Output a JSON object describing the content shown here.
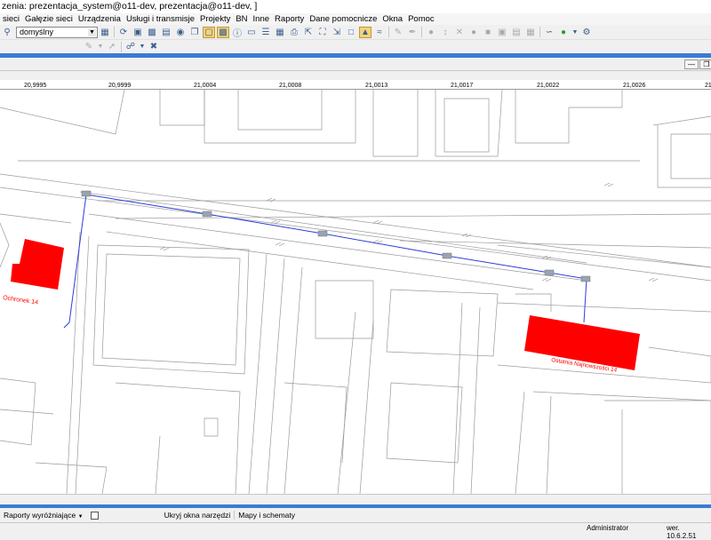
{
  "window": {
    "title": "zenia: prezentacja_system@o11-dev, prezentacja@o11-dev, ]"
  },
  "menu": {
    "items": [
      "sieci",
      "Gałęzie sieci",
      "Urządzenia",
      "Usługi i transmisje",
      "Projekty",
      "BN",
      "Inne",
      "Raporty",
      "Dane pomocnicze",
      "Okna",
      "Pomoc"
    ]
  },
  "toolbar": {
    "combo_value": "domyślny"
  },
  "ruler": {
    "ticks": [
      "20,9995",
      "20,9999",
      "21,0004",
      "21,0008",
      "21,0013",
      "21,0017",
      "21,0022",
      "21,0026",
      "21"
    ]
  },
  "map": {
    "labels": {
      "building1": "Ochronek 14",
      "building2": "Ostatnia Najnowszości 14"
    },
    "colors": {
      "building": "#ff0000",
      "route": "#2b3fd8",
      "lines": "#9a9a9a"
    }
  },
  "taskbar": {
    "reports_label": "Raporty wyróżniające",
    "hide_tools_label": "Ukryj okna narzędzi",
    "maps_label": "Mapy i schematy"
  },
  "status": {
    "user": "Administrator",
    "version": "wer. 10.6.2.51"
  }
}
